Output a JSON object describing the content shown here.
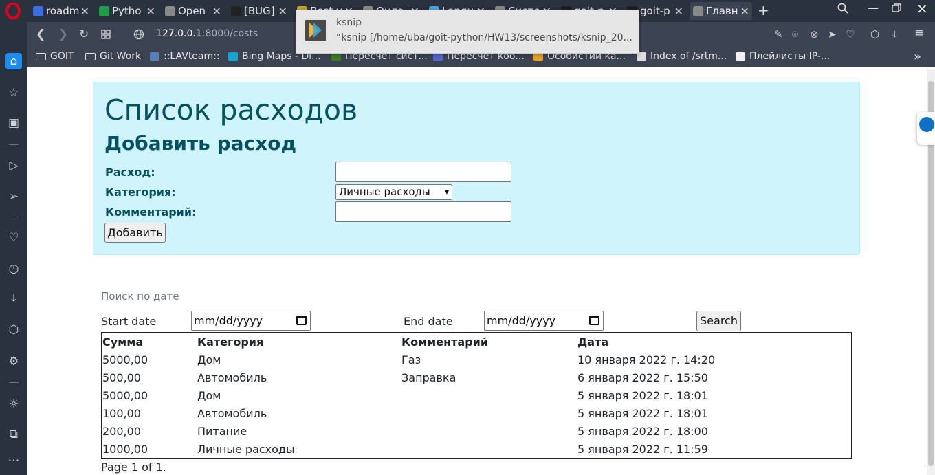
{
  "tabs": [
    {
      "label": "roadm",
      "icon": "document-icon",
      "color": "#3b6fe0"
    },
    {
      "label": "Pytho",
      "icon": "spreadsheet-icon",
      "color": "#1e9e4a"
    },
    {
      "label": "Open",
      "icon": "globe-icon",
      "color": "#888888"
    },
    {
      "label": "[BUG]",
      "icon": "github-icon",
      "color": "#222222"
    },
    {
      "label": "Best v",
      "icon": "bookmark-icon",
      "color": "#c9a227"
    },
    {
      "label": "Онла",
      "icon": "image-icon",
      "color": "#8a8a8a"
    },
    {
      "label": "Langu",
      "icon": "wave-icon",
      "color": "#4aa3df"
    },
    {
      "label": "Систе",
      "icon": "globe-icon",
      "color": "#888888"
    },
    {
      "label": "goit-p",
      "icon": "github-icon",
      "color": "#222222"
    },
    {
      "label": "goit-p",
      "icon": "github-icon",
      "color": "#222222"
    },
    {
      "label": "Главн",
      "icon": "globe-icon",
      "color": "#888888"
    }
  ],
  "address": {
    "host": "127.0.0.1",
    "path": ":8000/costs"
  },
  "notification": {
    "title": "ksnip",
    "body": "“ksnip [/home/uba/goit-python/HW13/screenshots/ksnip_20..."
  },
  "bookmarks": [
    {
      "label": "GOIT",
      "icon": "folder-icon"
    },
    {
      "label": "Git Work",
      "icon": "folder-icon"
    },
    {
      "label": "::LAVteam::",
      "icon": "lav-icon"
    },
    {
      "label": "Bing Maps - Di...",
      "icon": "bing-icon"
    },
    {
      "label": "Пересчет сист...",
      "icon": "globe-icon"
    },
    {
      "label": "Пересчет коо...",
      "icon": "map-icon"
    },
    {
      "label": "Особистий ка...",
      "icon": "bank-icon"
    },
    {
      "label": "Index of /srtm...",
      "icon": "page-icon"
    },
    {
      "label": "Плейлисты IP-...",
      "icon": "tv-icon"
    }
  ],
  "bookmarks_more": "»",
  "page": {
    "title": "Список расходов",
    "add_title": "Добавить расход",
    "expense_label": "Расход:",
    "category_label": "Категория:",
    "category_selected": "Личные расходы",
    "comment_label": "Комментарий:",
    "add_button": "Добавить",
    "search_caption": "Поиск по дате",
    "start_date_label": "Start date",
    "end_date_label": "End date",
    "date_placeholder": "mm/dd/yyyy",
    "search_button": "Search",
    "table": {
      "headers": [
        "Сумма",
        "Категория",
        "Комментарий",
        "Дата"
      ],
      "rows": [
        [
          "5000,00",
          "Дом",
          "Газ",
          "10 января 2022 г. 14:20"
        ],
        [
          "500,00",
          "Автомобиль",
          "Заправка",
          "6 января 2022 г. 15:50"
        ],
        [
          "5000,00",
          "Дом",
          "",
          "5 января 2022 г. 18:01"
        ],
        [
          "100,00",
          "Автомобиль",
          "",
          "5 января 2022 г. 18:01"
        ],
        [
          "200,00",
          "Питание",
          "",
          "5 января 2022 г. 18:00"
        ],
        [
          "1000,00",
          "Личные расходы",
          "",
          "5 января 2022 г. 11:59"
        ]
      ]
    },
    "pager": "Page 1 of 1."
  },
  "colors": {
    "chrome": "#2b323f",
    "toolbar": "#3c4454",
    "jumbotron_bg": "#cff4fc",
    "jumbotron_text": "#055160",
    "opera_red": "#e0001b"
  }
}
